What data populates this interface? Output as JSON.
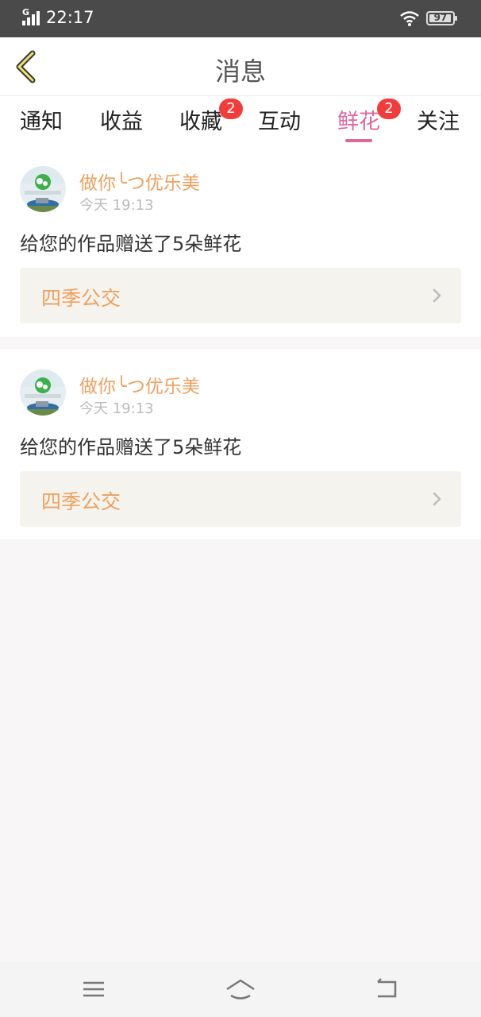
{
  "status_bar": {
    "network": "G",
    "time": "22:17",
    "battery": "97",
    "icons": [
      "signal-icon",
      "wifi-icon",
      "battery-icon"
    ]
  },
  "header": {
    "title": "消息",
    "back_icon": "chevron-left-icon"
  },
  "tabs": [
    {
      "label": "通知",
      "badge": "",
      "active": false
    },
    {
      "label": "收益",
      "badge": "",
      "active": false
    },
    {
      "label": "收藏",
      "badge": "2",
      "active": false
    },
    {
      "label": "互动",
      "badge": "",
      "active": false
    },
    {
      "label": "鲜花",
      "badge": "2",
      "active": true
    },
    {
      "label": "关注",
      "badge": "",
      "active": false
    }
  ],
  "messages": [
    {
      "user": "做你╰つ优乐美",
      "time": "今天 19:13",
      "text": "给您的作品赠送了5朵鲜花",
      "work_title": "四季公交"
    },
    {
      "user": "做你╰つ优乐美",
      "time": "今天 19:13",
      "text": "给您的作品赠送了5朵鲜花",
      "work_title": "四季公交"
    }
  ],
  "nav_icons": [
    "menu-icon",
    "home-icon",
    "back-icon"
  ],
  "colors": {
    "accent": "#e0679e",
    "username": "#f0a05e",
    "badge": "#f23c3c",
    "status_bar": "#4a4a4a"
  }
}
